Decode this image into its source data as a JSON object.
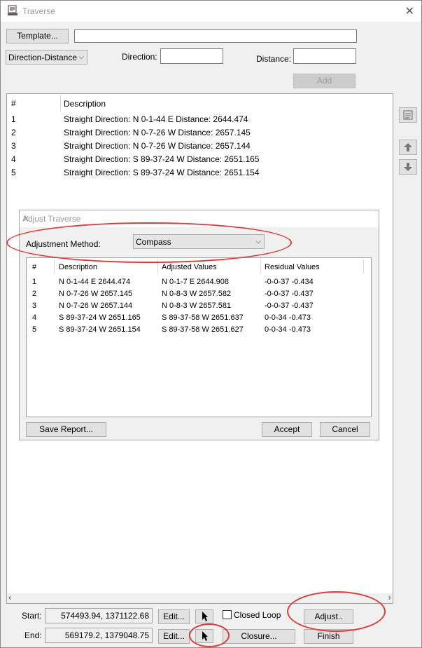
{
  "window": {
    "title": "Traverse",
    "close_glyph": "✕",
    "app_icon": "survey-document-icon"
  },
  "top": {
    "template_button": "Template...",
    "template_value": "",
    "mode_select": "Direction-Distance",
    "direction_label": "Direction:",
    "direction_value": "",
    "distance_label": "Distance:",
    "distance_value": "",
    "add_button": "Add"
  },
  "traverse_list": {
    "columns": [
      "#",
      "Description"
    ],
    "rows": [
      {
        "num": "1",
        "desc": "Straight  Direction: N 0-1-44 E  Distance: 2644.474"
      },
      {
        "num": "2",
        "desc": "Straight  Direction: N 0-7-26 W  Distance: 2657.145"
      },
      {
        "num": "3",
        "desc": "Straight  Direction: N 0-7-26 W  Distance: 2657.144"
      },
      {
        "num": "4",
        "desc": "Straight  Direction: S 89-37-24 W  Distance: 2651.165"
      },
      {
        "num": "5",
        "desc": "Straight  Direction: S 89-37-24 W  Distance: 2651.154"
      }
    ]
  },
  "side_buttons": {
    "properties_icon": "properties-icon",
    "up_icon": "arrow-up-icon",
    "down_icon": "arrow-down-icon"
  },
  "adjust_dialog": {
    "title": "Adjust Traverse",
    "close_glyph": "✕",
    "method_label": "Adjustment Method:",
    "method_value": "Compass",
    "columns": [
      "#",
      "Description",
      "Adjusted Values",
      "Residual Values"
    ],
    "rows": [
      {
        "num": "1",
        "desc": "N 0-1-44 E  2644.474",
        "adjusted": "N 0-1-7 E  2644.908",
        "residual": "-0-0-37  -0.434"
      },
      {
        "num": "2",
        "desc": "N 0-7-26 W  2657.145",
        "adjusted": "N 0-8-3 W  2657.582",
        "residual": "-0-0-37  -0.437"
      },
      {
        "num": "3",
        "desc": "N 0-7-26 W  2657.144",
        "adjusted": "N 0-8-3 W  2657.581",
        "residual": "-0-0-37  -0.437"
      },
      {
        "num": "4",
        "desc": "S 89-37-24 W  2651.165",
        "adjusted": "S 89-37-58 W  2651.637",
        "residual": "0-0-34  -0.473"
      },
      {
        "num": "5",
        "desc": "S 89-37-24 W  2651.154",
        "adjusted": "S 89-37-58 W  2651.627",
        "residual": "0-0-34  -0.473"
      }
    ],
    "save_report_button": "Save Report...",
    "accept_button": "Accept",
    "cancel_button": "Cancel"
  },
  "bottom": {
    "start_label": "Start:",
    "start_value": "574493.94,  1371122.68",
    "end_label": "End:",
    "end_value": "569179.2,  1379048.75",
    "edit_button": "Edit...",
    "closed_loop_label": "Closed Loop",
    "closed_loop_checked": false,
    "closure_button": "Closure...",
    "adjust_button": "Adjust..",
    "finish_button": "Finish",
    "scroll_left": "‹",
    "scroll_right": "›"
  },
  "colors": {
    "annotation": "#e03a3a"
  }
}
